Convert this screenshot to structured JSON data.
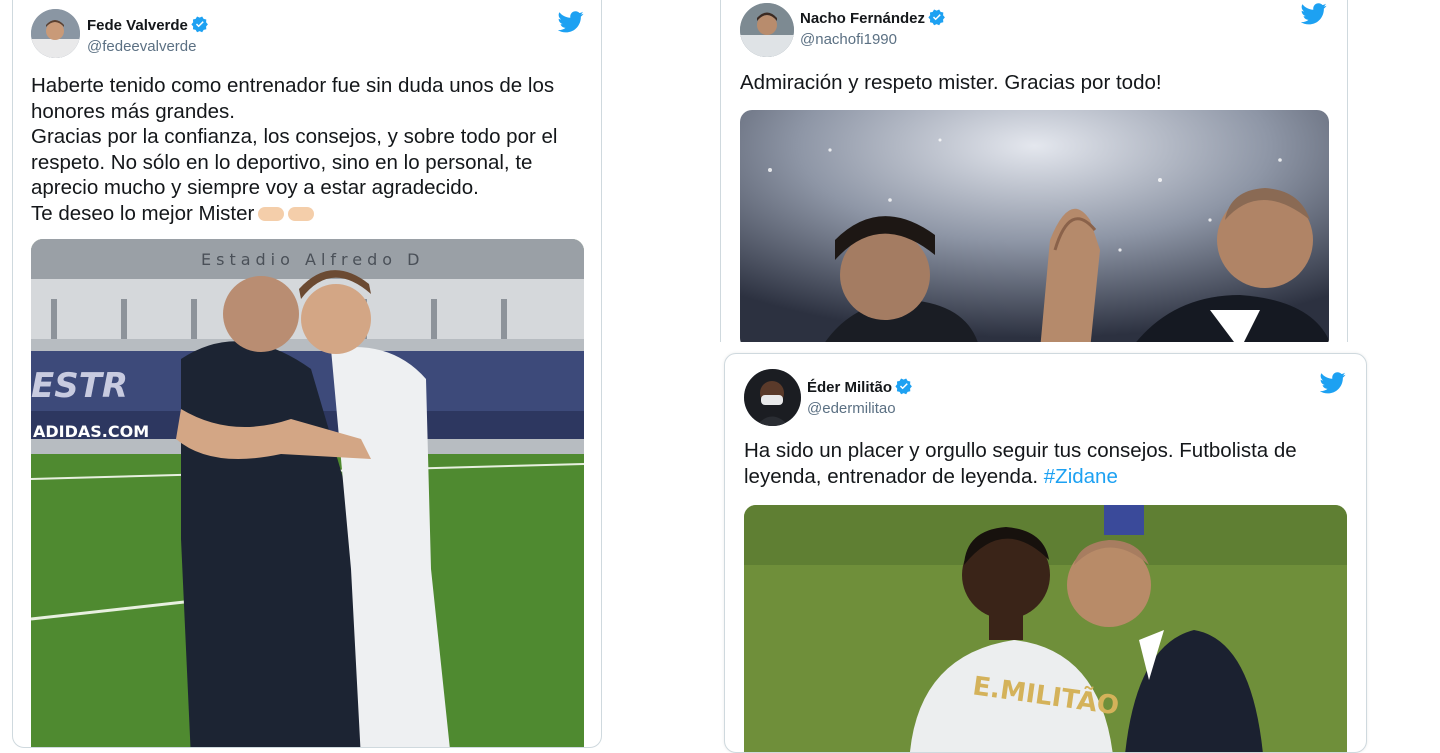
{
  "tweets": [
    {
      "display_name": "Fede Valverde",
      "handle": "@fedeevalverde",
      "text": "Haberte tenido como entrenador fue sin duda unos de los honores más grandes.\nGracias por la confianza, los consejos, y sobre todo por el respeto. No sólo en lo deportivo, sino en lo personal, te aprecio mucho y siempre voy a estar agradecido.\nTe deseo lo mejor Mister",
      "emoji": "fist-bump-emoji",
      "image_text": "Estadio Alfredo D",
      "image_ad_text": "ADIDAS.COM",
      "image_banner_text": "ESTR"
    },
    {
      "display_name": "Nacho Fernández",
      "handle": "@nachofi1990",
      "text": "Admiración y respeto mister. Gracias por todo!"
    },
    {
      "display_name": "Éder Militão",
      "handle": "@edermilitao",
      "text": "Ha sido un placer y orgullo seguir tus consejos. Futbolista de leyenda, entrenador de leyenda. ",
      "hashtag": "#Zidane",
      "image_text": "E.MILITÃO"
    }
  ],
  "colors": {
    "twitter_blue": "#1da1f2",
    "verified_blue": "#1da1f2",
    "text": "#14171a",
    "secondary": "#5b7083",
    "border": "#cfd9de"
  },
  "icons": [
    "twitter-bird-icon",
    "verified-badge-icon"
  ]
}
